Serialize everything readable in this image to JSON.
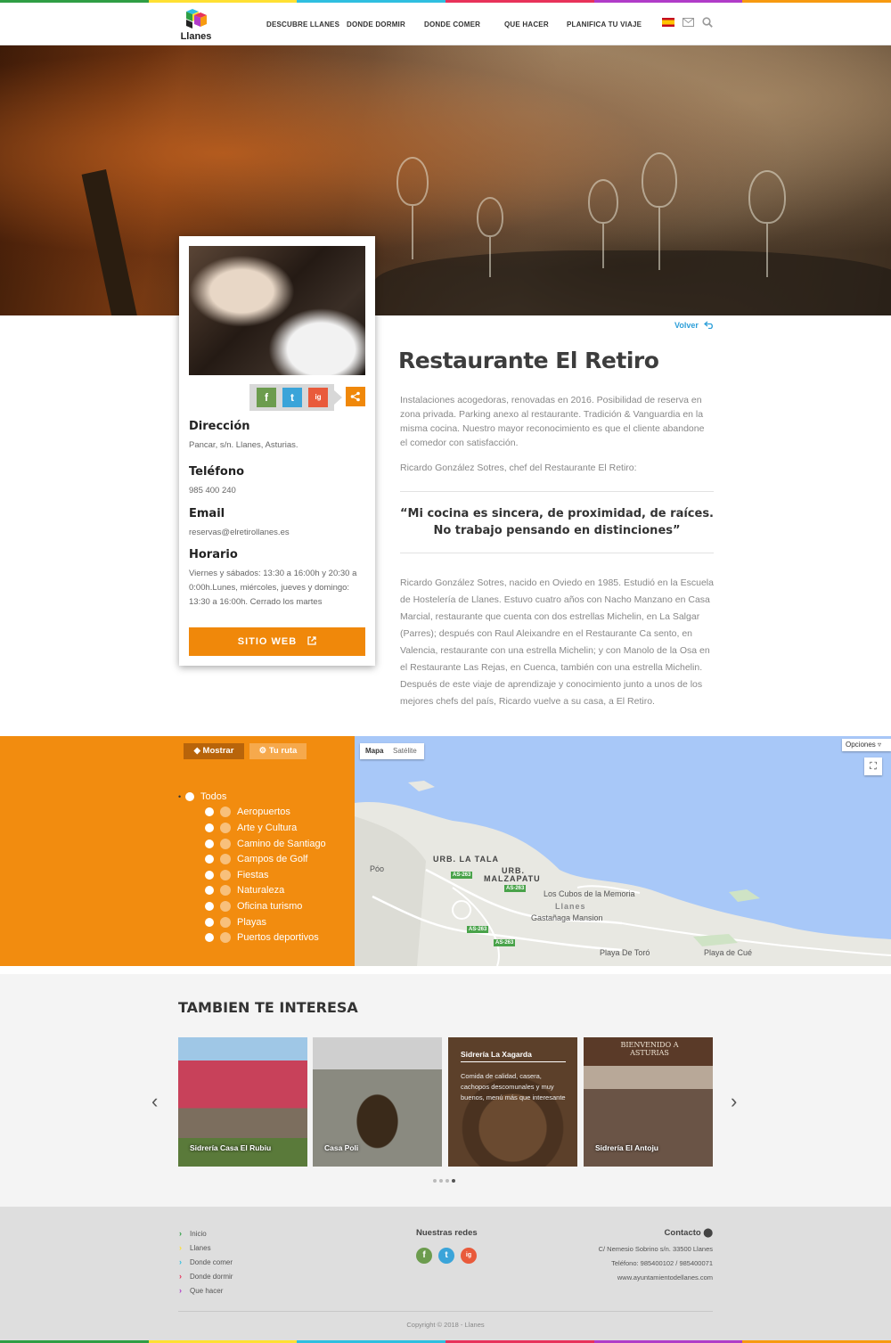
{
  "colors": {
    "accent": "#f0880a",
    "map_panel": "#f28c0f",
    "link_blue": "#2d9fd9",
    "facebook": "#6c9c4e",
    "twitter": "#3aa4d9",
    "instagram": "#e95a3b"
  },
  "rainbow": [
    "#2f9e44",
    "#ffe033",
    "#2fbfe0",
    "#e8325a",
    "#b03cc8",
    "#f79a10"
  ],
  "header": {
    "logo_text": "Llanes",
    "nav": [
      "DESCUBRE LLANES",
      "DONDE DORMIR",
      "DONDE COMER",
      "QUE HACER",
      "PLANIFICA TU VIAJE"
    ],
    "icons": [
      "spain-flag",
      "mail-icon",
      "search-icon"
    ]
  },
  "card": {
    "social": [
      "f",
      "t",
      "ig"
    ],
    "direccion_label": "Dirección",
    "direccion": "Pancar, s/n. Llanes, Asturias.",
    "telefono_label": "Teléfono",
    "telefono": "985 400 240",
    "email_label": "Email",
    "email": "reservas@elretirollanes.es",
    "horario_label": "Horario",
    "horario": "Viernes y sábados: 13:30 a 16:00h y 20:30 a 0:00h.Lunes, miércoles, jueves y domingo: 13:30 a 16:00h. Cerrado los martes",
    "web_button": "SITIO WEB"
  },
  "main": {
    "volver": "Volver",
    "title": "Restaurante El Retiro",
    "description": "Instalaciones acogedoras, renovadas en 2016.  Posibilidad de reserva en zona privada. Parking anexo al restaurante. Tradición & Vanguardia en la misma cocina. Nuestro mayor reconocimiento es que el cliente abandone el comedor con satisfacción.",
    "signature": "Ricardo González Sotres, chef del Restaurante El Retiro:",
    "quote_line1": "“Mi cocina es sincera, de proximidad, de raíces.",
    "quote_line2": "No trabajo pensando en distinciones”",
    "bio": "Ricardo González Sotres, nacido en Oviedo en 1985. Estudió en la Escuela de Hostelería de Llanes. Estuvo cuatro años con Nacho Manzano en Casa Marcial, restaurante que cuenta con dos estrellas Michelin, en La Salgar (Parres); después con Raul Aleixandre en el Restaurante Ca sento, en Valencia, restaurante con una estrella Michelin; y con Manolo de la Osa en el Restaurante Las Rejas, en Cuenca, también con una estrella Michelin. Después de este viaje de aprendizaje y conocimiento junto a unos de los mejores chefs del país, Ricardo vuelve a su casa, a El Retiro."
  },
  "map": {
    "tab_show": "Mostrar",
    "tab_route": "Tu ruta",
    "filters": [
      "Todos",
      "Aeropuertos",
      "Arte y Cultura",
      "Camino de Santiago",
      "Campos de Golf",
      "Fiestas",
      "Naturaleza",
      "Oficina turismo",
      "Playas",
      "Puertos deportivos"
    ],
    "type_map": "Mapa",
    "type_sat": "Satélite",
    "options": "Opciones",
    "labels": {
      "poo": "Póo",
      "urb_la_tala": "URB. LA TALA",
      "urb_malzapatu_1": "URB.",
      "urb_malzapatu_2": "MALZAPATU",
      "cubos": "Los Cubos de la Memoria",
      "llanes": "Llanes",
      "gastanaga": "Gastañaga Mansion",
      "playa_toro": "Playa De Toró",
      "playa_cue": "Playa de Cué",
      "road": "AS-263"
    }
  },
  "related": {
    "title": "TAMBIEN TE INTERESA",
    "items": [
      {
        "name": "Sidrería Casa El Rubiu"
      },
      {
        "name": "Casa Poli"
      },
      {
        "name": "Sidrería La Xagarda",
        "description": "Comida de calidad, casera, cachopos descomunales y muy buenos, menú más que interesante"
      },
      {
        "name": "Sidrería El Antoju",
        "sign": "BIENVENIDO A ASTURIAS"
      }
    ],
    "active_dot": 3
  },
  "footer": {
    "links": [
      "Inicio",
      "Llanes",
      "Donde comer",
      "Donde dormir",
      "Que hacer"
    ],
    "link_colors": [
      "#2f9e44",
      "#ffe033",
      "#2fbfe0",
      "#e8325a",
      "#b03cc8"
    ],
    "redes_title": "Nuestras redes",
    "contacto_title": "Contacto",
    "address": "C/ Nemesio Sobrino s/n. 33500 Llanes",
    "phones": "Teléfono: 985400102 / 985400071",
    "website": "www.ayuntamientodellanes.com",
    "copyright": "Copyright © 2018 - Llanes"
  }
}
